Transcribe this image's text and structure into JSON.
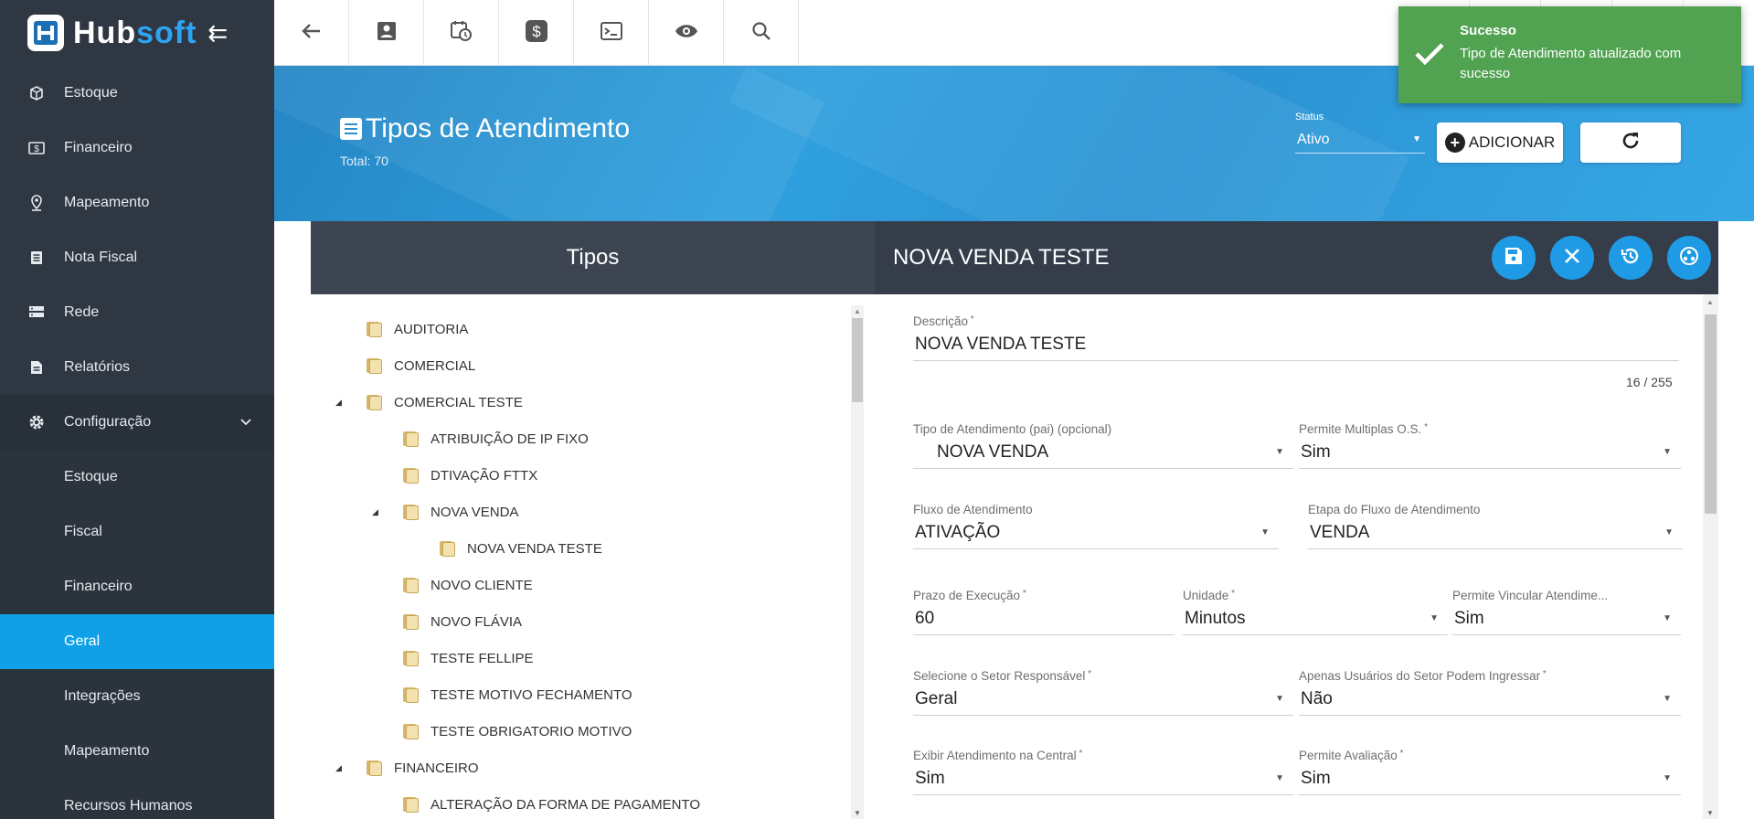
{
  "brand": {
    "name_part1": "Hub",
    "name_part2": "soft"
  },
  "sidebar": {
    "items": [
      {
        "label": "Estoque",
        "icon": "box-icon"
      },
      {
        "label": "Financeiro",
        "icon": "money-icon"
      },
      {
        "label": "Mapeamento",
        "icon": "map-pin-icon"
      },
      {
        "label": "Nota Fiscal",
        "icon": "document-icon"
      },
      {
        "label": "Rede",
        "icon": "server-icon"
      },
      {
        "label": "Relatórios",
        "icon": "report-icon"
      },
      {
        "label": "Configuração",
        "icon": "gear-icon"
      }
    ],
    "submenu": [
      {
        "label": "Estoque"
      },
      {
        "label": "Fiscal"
      },
      {
        "label": "Financeiro"
      },
      {
        "label": "Geral",
        "active": true
      },
      {
        "label": "Integrações"
      },
      {
        "label": "Mapeamento"
      },
      {
        "label": "Recursos Humanos"
      }
    ]
  },
  "topbar": {
    "buttons": [
      "back-arrow-icon",
      "contact-card-icon",
      "calendar-clock-icon",
      "dollar-icon",
      "terminal-icon",
      "eye-icon",
      "search-icon"
    ]
  },
  "header": {
    "title": "Tipos de Atendimento",
    "total": "Total: 70",
    "status_label": "Status",
    "status_value": "Ativo",
    "add_label": "ADICIONAR"
  },
  "panel": {
    "tree_title": "Tipos",
    "record_title": "NOVA VENDA TESTE"
  },
  "tree": [
    {
      "label": "AUDITORIA",
      "level": 1,
      "toggle": ""
    },
    {
      "label": "COMERCIAL",
      "level": 1,
      "toggle": ""
    },
    {
      "label": "COMERCIAL TESTE",
      "level": 1,
      "toggle": "◢"
    },
    {
      "label": "ATRIBUIÇÃO DE IP FIXO",
      "level": 2,
      "toggle": ""
    },
    {
      "label": "DTIVAÇÃO FTTX",
      "level": 2,
      "toggle": ""
    },
    {
      "label": "NOVA VENDA",
      "level": 2,
      "toggle": "◢"
    },
    {
      "label": "NOVA VENDA TESTE",
      "level": 3,
      "toggle": ""
    },
    {
      "label": "NOVO CLIENTE",
      "level": 2,
      "toggle": ""
    },
    {
      "label": "NOVO FLÁVIA",
      "level": 2,
      "toggle": ""
    },
    {
      "label": "TESTE FELLIPE",
      "level": 2,
      "toggle": ""
    },
    {
      "label": "TESTE MOTIVO FECHAMENTO",
      "level": 2,
      "toggle": ""
    },
    {
      "label": "TESTE OBRIGATORIO MOTIVO",
      "level": 2,
      "toggle": ""
    },
    {
      "label": "FINANCEIRO",
      "level": 1,
      "toggle": "◢"
    },
    {
      "label": "ALTERAÇÃO DA FORMA DE PAGAMENTO",
      "level": 2,
      "toggle": ""
    }
  ],
  "form": {
    "descricao": {
      "label": "Descrição",
      "value": "NOVA VENDA TESTE",
      "counter": "16 / 255"
    },
    "tipo_pai": {
      "label": "Tipo de Atendimento (pai) (opcional)",
      "value": "NOVA VENDA"
    },
    "permite_multiplas": {
      "label": "Permite Multiplas O.S.",
      "value": "Sim"
    },
    "fluxo": {
      "label": "Fluxo de Atendimento",
      "value": "ATIVAÇÃO"
    },
    "etapa": {
      "label": "Etapa do Fluxo de Atendimento",
      "value": "VENDA"
    },
    "prazo": {
      "label": "Prazo de Execução",
      "value": "60"
    },
    "unidade": {
      "label": "Unidade",
      "value": "Minutos"
    },
    "vincular": {
      "label": "Permite Vincular Atendime...",
      "value": "Sim"
    },
    "setor": {
      "label": "Selecione o Setor Responsável",
      "value": "Geral"
    },
    "apenas_usuarios": {
      "label": "Apenas Usuários do Setor Podem Ingressar",
      "value": "Não"
    },
    "exibir_central": {
      "label": "Exibir Atendimento na Central",
      "value": "Sim"
    },
    "avaliacao": {
      "label": "Permite Avaliação",
      "value": "Sim"
    }
  },
  "toast": {
    "title": "Sucesso",
    "message": "Tipo de Atendimento atualizado com sucesso"
  },
  "colors": {
    "accent": "#0fa0e8",
    "sidebar": "#2f3742",
    "toast": "#51a351"
  }
}
